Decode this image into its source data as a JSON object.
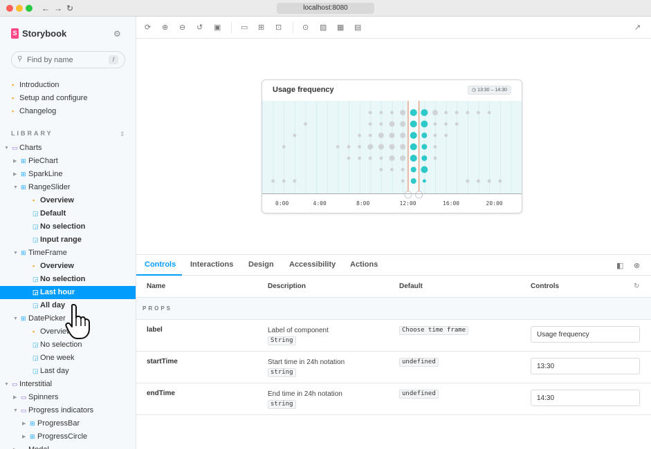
{
  "browser": {
    "url": "localhost:8080",
    "nav": {
      "back": "←",
      "forward": "→",
      "reload": "↻"
    }
  },
  "sidebar": {
    "brand": "Storybook",
    "logo_letter": "S",
    "search_placeholder": "Find by name",
    "search_shortcut": "/",
    "library_label": "LIBRARY",
    "docs": [
      {
        "label": "Introduction"
      },
      {
        "label": "Setup and configure"
      },
      {
        "label": "Changelog"
      }
    ],
    "tree": [
      {
        "label": "Charts",
        "kind": "folder",
        "level": 0,
        "expanded": true
      },
      {
        "label": "PieChart",
        "kind": "component",
        "level": 1,
        "expanded": false
      },
      {
        "label": "SparkLine",
        "kind": "component",
        "level": 1,
        "expanded": false
      },
      {
        "label": "RangeSlider",
        "kind": "component",
        "level": 1,
        "expanded": true
      },
      {
        "label": "Overview",
        "kind": "doc",
        "level": 2,
        "bold": true
      },
      {
        "label": "Default",
        "kind": "story",
        "level": 2,
        "bold": true
      },
      {
        "label": "No selection",
        "kind": "story",
        "level": 2,
        "bold": true
      },
      {
        "label": "Input range",
        "kind": "story",
        "level": 2,
        "bold": true
      },
      {
        "label": "TimeFrame",
        "kind": "component",
        "level": 1,
        "expanded": true
      },
      {
        "label": "Overview",
        "kind": "doc",
        "level": 2,
        "bold": true
      },
      {
        "label": "No selection",
        "kind": "story",
        "level": 2,
        "bold": true
      },
      {
        "label": "Last hour",
        "kind": "story",
        "level": 2,
        "bold": true,
        "selected": true
      },
      {
        "label": "All day",
        "kind": "story",
        "level": 2,
        "bold": true
      },
      {
        "label": "DatePicker",
        "kind": "component",
        "level": 1,
        "expanded": true
      },
      {
        "label": "Overview",
        "kind": "doc",
        "level": 2
      },
      {
        "label": "No selection",
        "kind": "story",
        "level": 2
      },
      {
        "label": "One week",
        "kind": "story",
        "level": 2
      },
      {
        "label": "Last day",
        "kind": "story",
        "level": 2
      },
      {
        "label": "Interstitial",
        "kind": "folder",
        "level": 0,
        "expanded": true
      },
      {
        "label": "Spinners",
        "kind": "folder",
        "level": 1,
        "expanded": false
      },
      {
        "label": "Progress indicators",
        "kind": "folder",
        "level": 1,
        "expanded": true
      },
      {
        "label": "ProgressBar",
        "kind": "component",
        "level": 2,
        "expanded": false
      },
      {
        "label": "ProgressCircle",
        "kind": "component",
        "level": 2,
        "expanded": false
      },
      {
        "label": "Modal",
        "kind": "folder",
        "level": 1,
        "expanded": false
      }
    ]
  },
  "preview": {
    "title": "Usage frequency",
    "range_badge": "13:30 – 14:30",
    "ticks": [
      "0:00",
      "4:00",
      "8:00",
      "12:00",
      "16:00",
      "20:00"
    ]
  },
  "chart_data": {
    "type": "scatter",
    "title": "Usage frequency",
    "x_domain": [
      0,
      24
    ],
    "x_ticks": [
      "0:00",
      "4:00",
      "8:00",
      "12:00",
      "16:00",
      "20:00"
    ],
    "selection": {
      "start": "13:30",
      "end": "14:30"
    },
    "rows": 8,
    "columns": [
      {
        "hour": 1,
        "dots": [
          [
            7,
            1
          ]
        ]
      },
      {
        "hour": 2,
        "dots": [
          [
            7,
            1
          ],
          [
            4,
            1
          ]
        ]
      },
      {
        "hour": 3,
        "dots": [
          [
            7,
            1
          ],
          [
            3,
            1
          ]
        ]
      },
      {
        "hour": 4,
        "dots": [
          [
            2,
            1
          ]
        ]
      },
      {
        "hour": 7,
        "dots": [
          [
            4,
            1
          ]
        ]
      },
      {
        "hour": 8,
        "dots": [
          [
            4,
            1
          ],
          [
            5,
            1
          ]
        ]
      },
      {
        "hour": 9,
        "dots": [
          [
            3,
            1
          ],
          [
            4,
            1
          ],
          [
            5,
            1
          ]
        ]
      },
      {
        "hour": 10,
        "dots": [
          [
            1,
            1
          ],
          [
            2,
            1
          ],
          [
            3,
            1
          ],
          [
            4,
            2
          ],
          [
            5,
            1
          ]
        ]
      },
      {
        "hour": 11,
        "dots": [
          [
            1,
            1
          ],
          [
            2,
            1
          ],
          [
            3,
            2
          ],
          [
            4,
            2
          ],
          [
            5,
            1
          ],
          [
            6,
            1
          ]
        ]
      },
      {
        "hour": 12,
        "dots": [
          [
            1,
            1
          ],
          [
            2,
            2
          ],
          [
            3,
            2
          ],
          [
            4,
            2
          ],
          [
            5,
            2
          ],
          [
            6,
            1
          ]
        ]
      },
      {
        "hour": 13,
        "dots": [
          [
            1,
            2
          ],
          [
            2,
            2
          ],
          [
            3,
            2
          ],
          [
            4,
            2
          ],
          [
            5,
            2
          ],
          [
            6,
            1
          ],
          [
            7,
            1
          ]
        ]
      },
      {
        "hour": 14,
        "dots": [
          [
            1,
            3
          ],
          [
            2,
            3
          ],
          [
            3,
            3
          ],
          [
            4,
            3
          ],
          [
            5,
            3
          ],
          [
            6,
            2
          ],
          [
            7,
            2
          ]
        ]
      },
      {
        "hour": 15,
        "dots": [
          [
            1,
            3
          ],
          [
            2,
            3
          ],
          [
            3,
            2
          ],
          [
            4,
            2
          ],
          [
            5,
            2
          ],
          [
            6,
            3
          ],
          [
            7,
            1
          ]
        ]
      },
      {
        "hour": 16,
        "dots": [
          [
            1,
            2
          ],
          [
            2,
            1
          ],
          [
            3,
            1
          ],
          [
            4,
            1
          ],
          [
            5,
            1
          ]
        ]
      },
      {
        "hour": 17,
        "dots": [
          [
            1,
            1
          ],
          [
            2,
            1
          ],
          [
            3,
            1
          ]
        ]
      },
      {
        "hour": 18,
        "dots": [
          [
            1,
            1
          ],
          [
            2,
            1
          ]
        ]
      },
      {
        "hour": 19,
        "dots": [
          [
            1,
            1
          ],
          [
            7,
            1
          ]
        ]
      },
      {
        "hour": 20,
        "dots": [
          [
            1,
            1
          ],
          [
            7,
            1
          ]
        ]
      },
      {
        "hour": 21,
        "dots": [
          [
            1,
            1
          ],
          [
            7,
            1
          ]
        ]
      },
      {
        "hour": 22,
        "dots": [
          [
            7,
            1
          ]
        ]
      }
    ]
  },
  "panel": {
    "tabs": [
      "Controls",
      "Interactions",
      "Design",
      "Accessibility",
      "Actions"
    ],
    "columns": {
      "name": "Name",
      "description": "Description",
      "default": "Default",
      "controls": "Controls"
    },
    "section": "PROPS",
    "props": [
      {
        "name": "label",
        "description": "Label of component",
        "type": "String",
        "default": "Choose time frame",
        "value": "Usage frequency"
      },
      {
        "name": "startTime",
        "description": "Start time in 24h notation",
        "type": "string",
        "default": "undefined",
        "value": "13:30"
      },
      {
        "name": "endTime",
        "description": "End time in 24h notation",
        "type": "string",
        "default": "undefined",
        "value": "14:30"
      }
    ]
  },
  "colors": {
    "accent": "#029cfd",
    "brand": "#ff4785",
    "dot_active": "#2dc8c8",
    "dot_inactive": "#cfd3d6",
    "handle": "#e8a48b"
  }
}
